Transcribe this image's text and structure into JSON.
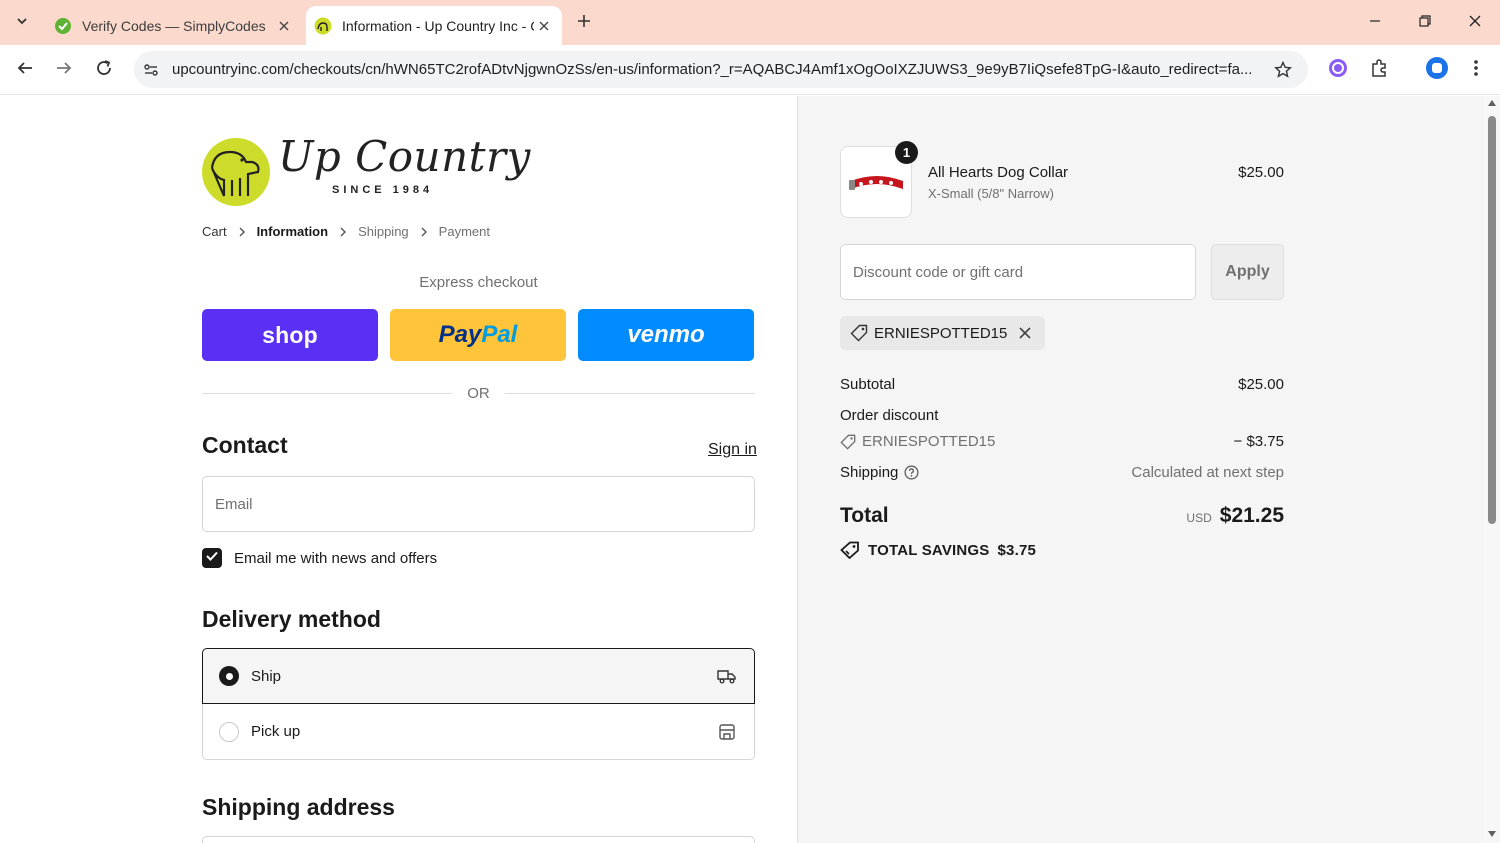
{
  "browser": {
    "tabs": [
      {
        "title": "Verify Codes — SimplyCodes",
        "active": false
      },
      {
        "title": "Information - Up Country Inc - C",
        "active": true
      }
    ],
    "url": "upcountryinc.com/checkouts/cn/hWN65TC2rofADtvNjgwnOzSs/en-us/information?_r=AQABCJ4Amf1xOgOoIXZJUWS3_9e9yB7IiQsefe8TpG-I&auto_redirect=fa..."
  },
  "store": {
    "logo_script": "Up Country",
    "logo_tagline": "SINCE 1984"
  },
  "breadcrumb": {
    "cart": "Cart",
    "information": "Information",
    "shipping": "Shipping",
    "payment": "Payment"
  },
  "express": {
    "label": "Express checkout",
    "shop": "shop",
    "paypal_a": "Pay",
    "paypal_b": "Pal",
    "venmo": "venmo",
    "or": "OR"
  },
  "contact": {
    "title": "Contact",
    "sign_in": "Sign in",
    "email_placeholder": "Email",
    "newsletter_label": "Email me with news and offers",
    "newsletter_checked": true
  },
  "delivery": {
    "title": "Delivery method",
    "options": [
      {
        "label": "Ship",
        "selected": true
      },
      {
        "label": "Pick up",
        "selected": false
      }
    ]
  },
  "shipping_address": {
    "title": "Shipping address"
  },
  "summary": {
    "product": {
      "name": "All Hearts Dog Collar",
      "variant": "X-Small (5/8\" Narrow)",
      "price": "$25.00",
      "quantity": "1"
    },
    "discount_placeholder": "Discount code or gift card",
    "apply_label": "Apply",
    "applied_code": "ERNIESPOTTED15",
    "subtotal_label": "Subtotal",
    "subtotal_value": "$25.00",
    "order_discount_label": "Order discount",
    "discount_code": "ERNIESPOTTED15",
    "discount_value": "− $3.75",
    "shipping_label": "Shipping",
    "shipping_value": "Calculated at next step",
    "total_label": "Total",
    "currency": "USD",
    "total_value": "$21.25",
    "savings_label": "TOTAL SAVINGS",
    "savings_value": "$3.75"
  },
  "colors": {
    "shop_pay": "#5a31f4",
    "paypal": "#ffc439",
    "venmo": "#008cff",
    "tabstrip": "#fbd9cd",
    "logo_badge": "#cddc2b"
  }
}
